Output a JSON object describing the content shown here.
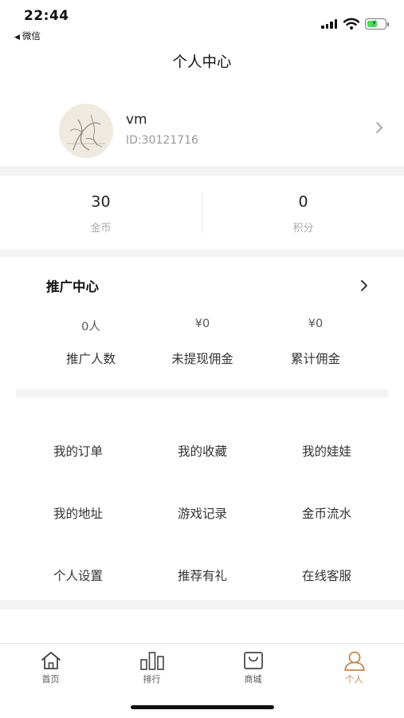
{
  "status_bar": {
    "time": "22:44",
    "back_app": "微信"
  },
  "header": {
    "title": "个人中心"
  },
  "profile": {
    "username": "vm",
    "user_id": "ID:30121716"
  },
  "stats": [
    {
      "value": "30",
      "label": "金币"
    },
    {
      "value": "0",
      "label": "积分"
    }
  ],
  "promotion": {
    "title": "推广中心",
    "items": [
      {
        "value": "0人",
        "label": "推广人数"
      },
      {
        "value": "¥0",
        "label": "未提现佣金"
      },
      {
        "value": "¥0",
        "label": "累计佣金"
      }
    ]
  },
  "menu": [
    {
      "label": "我的订单"
    },
    {
      "label": "我的收藏"
    },
    {
      "label": "我的娃娃"
    },
    {
      "label": "我的地址"
    },
    {
      "label": "游戏记录"
    },
    {
      "label": "金币流水"
    },
    {
      "label": "个人设置"
    },
    {
      "label": "推荐有礼"
    },
    {
      "label": "在线客服"
    }
  ],
  "tabbar": [
    {
      "label": "首页",
      "icon": "home-icon"
    },
    {
      "label": "排行",
      "icon": "ranking-icon"
    },
    {
      "label": "商城",
      "icon": "shop-bag-icon"
    },
    {
      "label": "个人",
      "icon": "person-icon",
      "active": true
    }
  ],
  "colors": {
    "accent": "#c8874a",
    "band": "#f3f3f3"
  }
}
